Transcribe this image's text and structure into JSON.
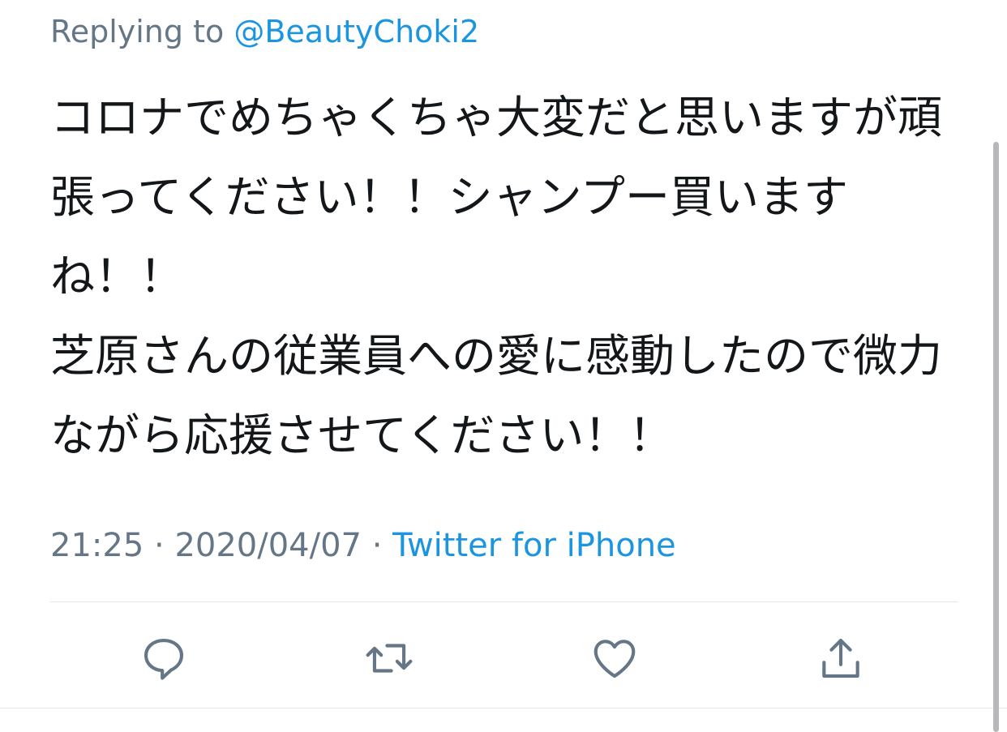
{
  "reply": {
    "prefix": "Replying to",
    "handle": "@BeautyChoki2"
  },
  "tweet": {
    "paragraphs": [
      "コロナでめちゃくちゃ大変だと思いますが頑張ってください！！シャンプー買いますね！！",
      "芝原さんの従業員への愛に感動したので微力ながら応援させてください！！"
    ]
  },
  "meta": {
    "time": "21:25",
    "separator": "·",
    "date": "2020/04/07",
    "source": "Twitter for iPhone"
  },
  "actions": [
    {
      "name": "reply",
      "icon": "reply-icon"
    },
    {
      "name": "retweet",
      "icon": "retweet-icon"
    },
    {
      "name": "like",
      "icon": "heart-icon"
    },
    {
      "name": "share",
      "icon": "share-icon"
    }
  ],
  "colors": {
    "text": "#14171a",
    "secondary": "#657786",
    "link": "#1b95e0",
    "divider": "#e1e8ed"
  }
}
